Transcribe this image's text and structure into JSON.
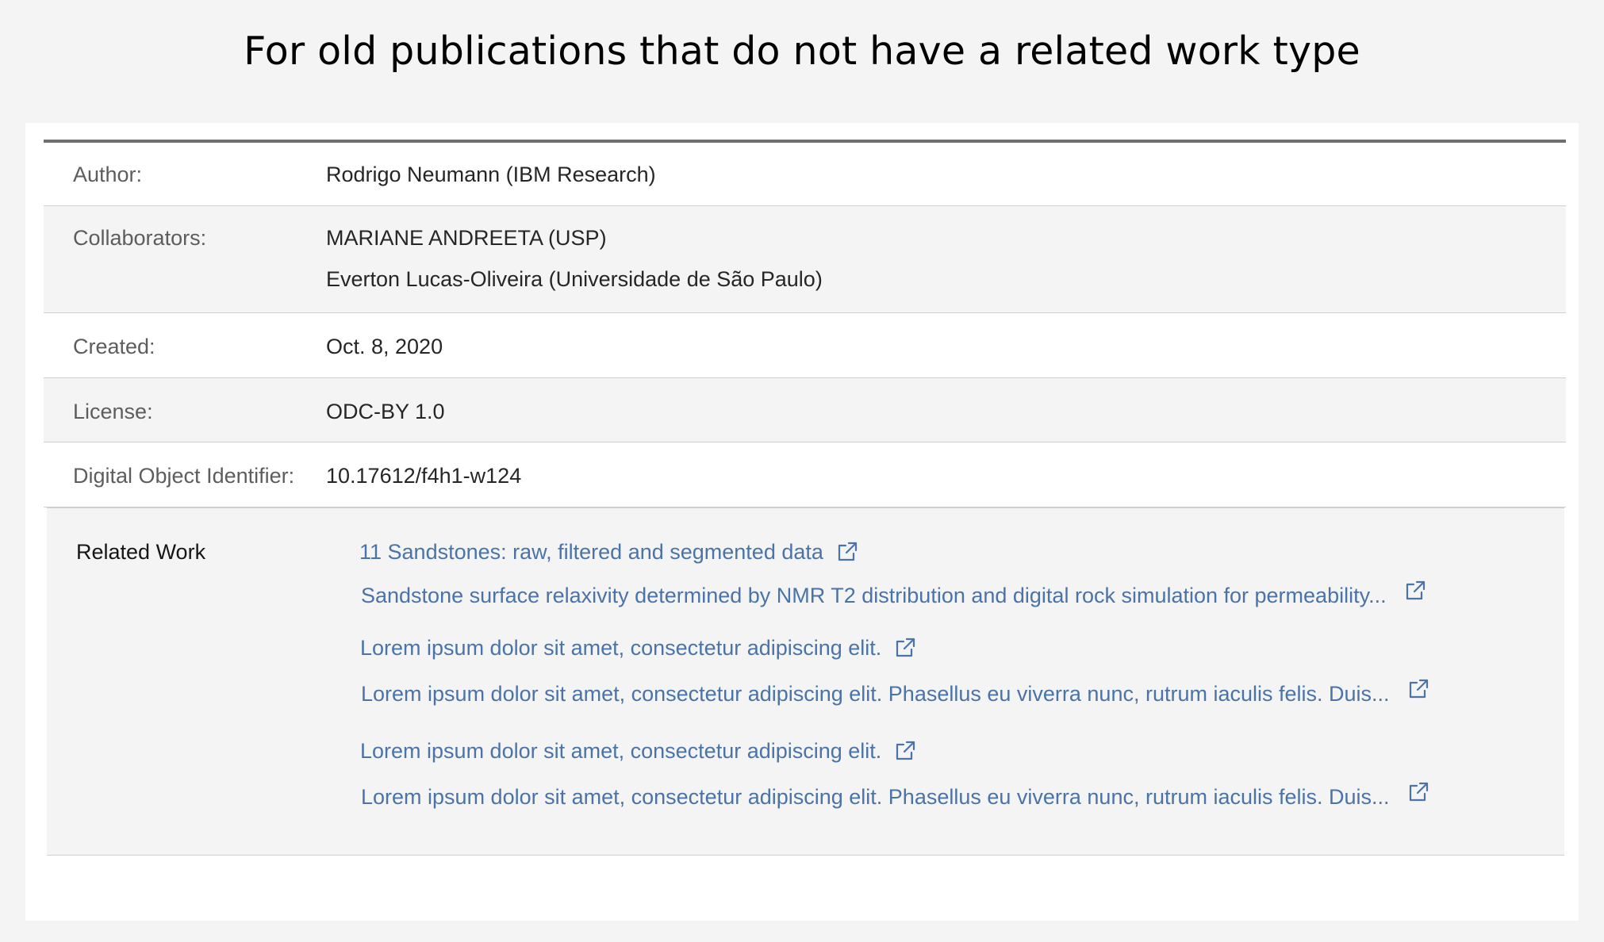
{
  "page": {
    "heading": "For old publications that do not have a related work type"
  },
  "metadata": {
    "rows": [
      {
        "label": "Author:",
        "values": [
          "Rodrigo Neumann (IBM Research)"
        ]
      },
      {
        "label": "Collaborators:",
        "values": [
          "MARIANE ANDREETA (USP)",
          "Everton Lucas-Oliveira (Universidade de São Paulo)"
        ]
      },
      {
        "label": "Created:",
        "values": [
          "Oct. 8, 2020"
        ]
      },
      {
        "label": "License:",
        "values": [
          "ODC-BY 1.0"
        ]
      },
      {
        "label": "Digital Object Identifier:",
        "values": [
          "10.17612/f4h1-w124"
        ]
      }
    ]
  },
  "related_work": {
    "label": "Related Work",
    "items": [
      {
        "text": "11 Sandstones: raw, filtered and segmented data",
        "icon": "external-link-icon"
      },
      {
        "text": "Sandstone surface relaxivity determined by NMR T2 distribution and digital rock simulation for permeability...",
        "icon": "external-link-icon"
      },
      {
        "text": "Lorem ipsum dolor sit amet, consectetur adipiscing elit.",
        "icon": "external-link-icon"
      },
      {
        "text": "Lorem ipsum dolor sit amet, consectetur adipiscing elit. Phasellus eu viverra nunc, rutrum iaculis felis. Duis...",
        "icon": "external-link-icon"
      },
      {
        "text": "Lorem ipsum dolor sit amet, consectetur adipiscing elit.",
        "icon": "external-link-icon"
      },
      {
        "text": "Lorem ipsum dolor sit amet, consectetur adipiscing elit. Phasellus eu viverra nunc, rutrum iaculis felis. Duis...",
        "icon": "external-link-icon"
      }
    ]
  },
  "colors": {
    "page_background": "#f4f4f4",
    "card_background": "#ffffff",
    "link": "#4a73a8",
    "table_top_border": "#6f6f6f",
    "row_divider": "#cfcfcf",
    "label_text": "#5d5d5d",
    "value_text": "#262626"
  }
}
